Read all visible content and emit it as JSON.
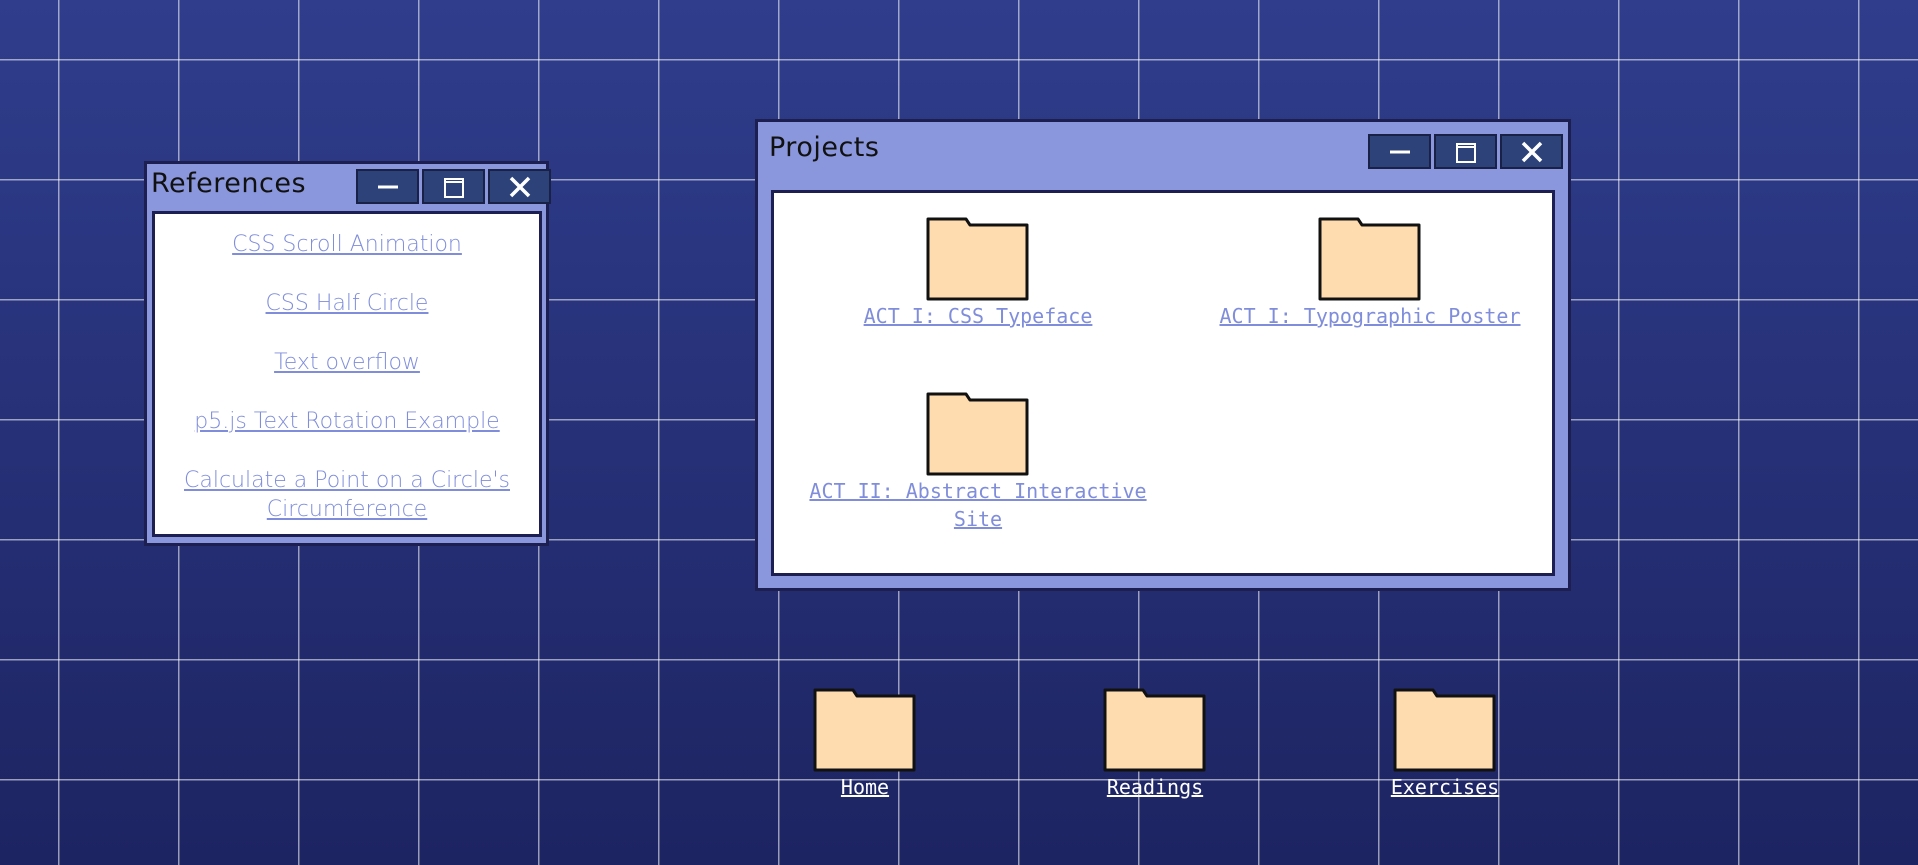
{
  "references_window": {
    "title": "References",
    "links": [
      {
        "label": "CSS Scroll Animation"
      },
      {
        "label": "CSS Half Circle"
      },
      {
        "label": "Text overflow"
      },
      {
        "label": "p5.js Text Rotation Example"
      },
      {
        "label": "Calculate a Point on a Circle's Circumference"
      }
    ]
  },
  "projects_window": {
    "title": "Projects",
    "folders": [
      {
        "label": "ACT I: CSS Typeface"
      },
      {
        "label": "ACT I: Typographic Poster"
      },
      {
        "label": "ACT II: Abstract Interactive Site"
      }
    ]
  },
  "desktop": {
    "folders": [
      {
        "label": "Home"
      },
      {
        "label": "Readings"
      },
      {
        "label": "Exercises"
      }
    ]
  },
  "colors": {
    "background": "#26306f",
    "window": "#8a97dc",
    "window_button": "#2c4279",
    "link": "#7f8ddb",
    "folder": "#ffdcb0"
  }
}
